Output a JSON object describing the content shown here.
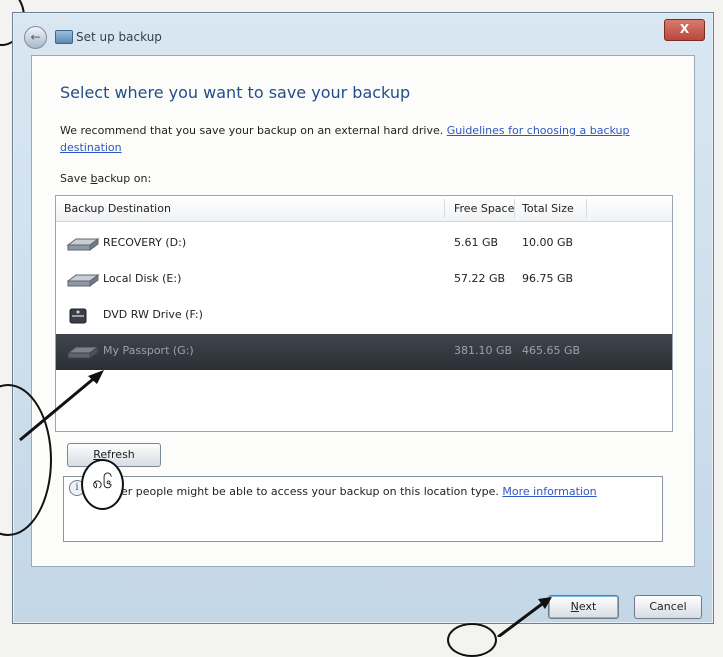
{
  "window": {
    "title": "Set up backup",
    "close_label": "X",
    "back_label": "←"
  },
  "main": {
    "heading": "Select where you want to save your backup",
    "description_prefix": "We recommend that you save your backup on an external hard drive. ",
    "description_link": "Guidelines for choosing a backup destination",
    "save_label_prefix": "Save ",
    "save_label_underlined": "b",
    "save_label_suffix": "ackup on:"
  },
  "destinations": {
    "columns": {
      "destination": "Backup Destination",
      "free_space": "Free Space",
      "total_size": "Total Size"
    },
    "rows": [
      {
        "name": "RECOVERY (D:)",
        "free_space": "5.61 GB",
        "total_size": "10.00 GB",
        "icon": "hard-drive-icon",
        "selected": false
      },
      {
        "name": "Local Disk (E:)",
        "free_space": "57.22 GB",
        "total_size": "96.75 GB",
        "icon": "hard-drive-icon",
        "selected": false
      },
      {
        "name": "DVD RW Drive (F:)",
        "free_space": "",
        "total_size": "",
        "icon": "dvd-drive-icon",
        "selected": false
      },
      {
        "name": "My Passport (G:)",
        "free_space": "381.10 GB",
        "total_size": "465.65 GB",
        "icon": "hard-drive-icon",
        "selected": true
      }
    ]
  },
  "refresh": {
    "underlined": "R",
    "rest": "efresh"
  },
  "info": {
    "icon_glyph": "i",
    "text": "Other people might be able to access your backup on this location type. ",
    "link": "More information"
  },
  "footer": {
    "next_underlined": "N",
    "next_rest": "ext",
    "cancel_label": "Cancel"
  },
  "annotation": {
    "badge_text": "၈၆"
  },
  "colors": {
    "heading": "#244e8a",
    "link": "#2f57c0",
    "selected_row": "#2b2f35"
  }
}
